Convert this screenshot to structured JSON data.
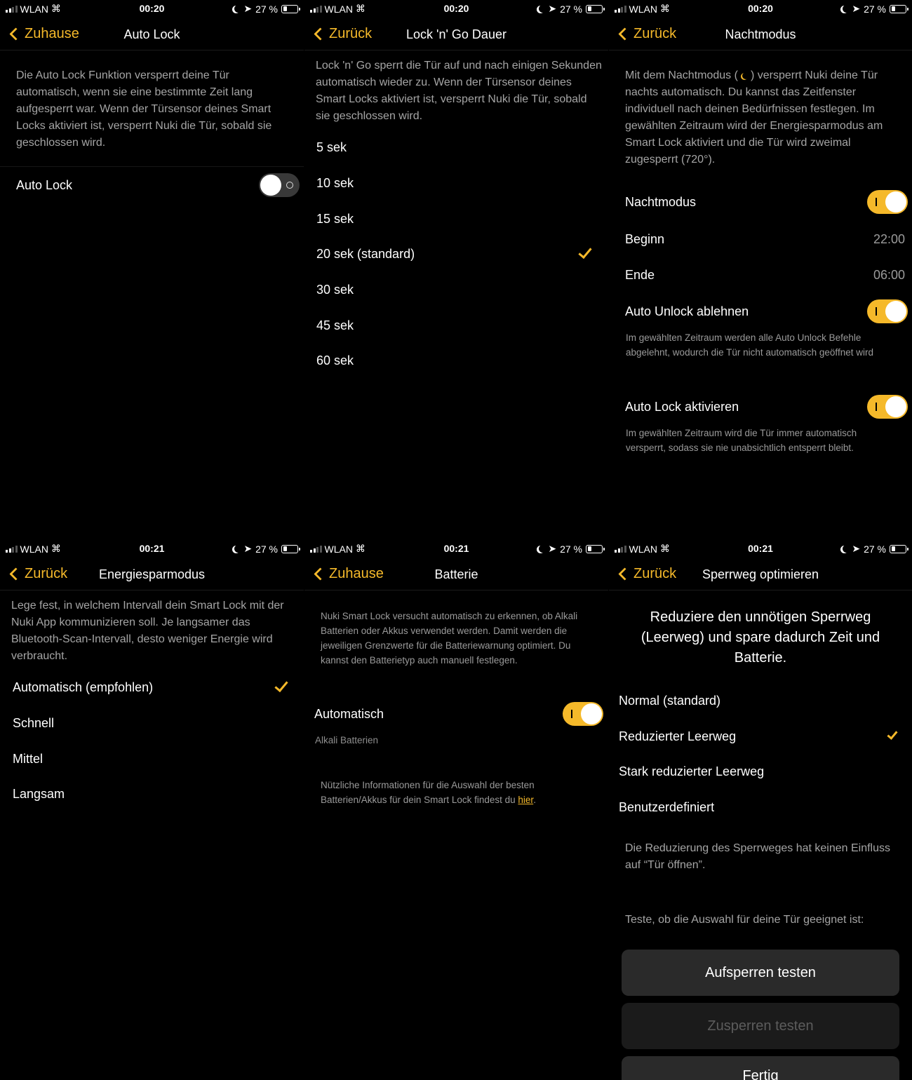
{
  "status": {
    "carrier": "WLAN",
    "battery_text": "27 %",
    "battery_level": 0.27,
    "time_top": "00:20",
    "time_bottom": "00:21"
  },
  "accent_color": "#f5b92a",
  "screens": {
    "auto_lock": {
      "back_label": "Zuhause",
      "title": "Auto Lock",
      "description": "Die Auto Lock Funktion versperrt deine Tür automatisch, wenn sie eine bestimmte Zeit lang aufgesperrt war. Wenn der Türsensor deines Smart Locks aktiviert ist, versperrt Nuki die Tür, sobald sie geschlossen wird.",
      "toggle_label": "Auto Lock",
      "toggle_on": false
    },
    "lock_n_go": {
      "back_label": "Zurück",
      "title": "Lock 'n' Go Dauer",
      "description": "Lock 'n' Go sperrt die Tür auf und nach einigen Sekunden automatisch wieder zu. Wenn der Türsensor deines Smart Locks aktiviert ist, versperrt Nuki die Tür, sobald sie geschlossen wird.",
      "options": [
        "5 sek",
        "10 sek",
        "15 sek",
        "20 sek (standard)",
        "30 sek",
        "45 sek",
        "60 sek"
      ],
      "selected": "20 sek (standard)"
    },
    "night_mode": {
      "back_label": "Zurück",
      "title": "Nachtmodus",
      "description_before": "Mit dem Nachtmodus (",
      "description_after": ") versperrt Nuki deine Tür nachts automatisch. Du kannst das Zeitfenster individuell nach deinen Bedürfnissen festlegen. Im gewählten Zeitraum wird der Energiesparmodus am Smart Lock aktiviert und die Tür wird zweimal zugesperrt (720°).",
      "nightmode_label": "Nachtmodus",
      "nightmode_on": true,
      "begin_label": "Beginn",
      "begin_value": "22:00",
      "end_label": "Ende",
      "end_value": "06:00",
      "auto_unlock_label": "Auto Unlock ablehnen",
      "auto_unlock_on": true,
      "auto_unlock_note": "Im gewählten Zeitraum werden alle Auto Unlock Befehle abgelehnt, wodurch die Tür nicht automatisch geöffnet wird",
      "auto_lock_label": "Auto Lock aktivieren",
      "auto_lock_on": true,
      "auto_lock_note": "Im gewählten Zeitraum wird die Tür immer automatisch versperrt, sodass sie nie unabsichtlich entsperrt bleibt."
    },
    "energy": {
      "back_label": "Zurück",
      "title": "Energiesparmodus",
      "description": "Lege fest, in welchem Intervall dein Smart Lock mit der Nuki App kommunizieren soll. Je langsamer das Bluetooth-Scan-Intervall, desto weniger Energie wird verbraucht.",
      "options": [
        "Automatisch (empfohlen)",
        "Schnell",
        "Mittel",
        "Langsam"
      ],
      "selected": "Automatisch (empfohlen)"
    },
    "battery": {
      "back_label": "Zuhause",
      "title": "Batterie",
      "description": "Nuki Smart Lock versucht automatisch zu erkennen, ob Alkali Batterien oder Akkus verwendet werden. Damit werden die jeweiligen Grenzwerte für die Batteriewarnung optimiert. Du kannst den Batterietyp auch manuell festlegen.",
      "auto_label": "Automatisch",
      "auto_on": true,
      "detected": "Alkali Batterien",
      "info_text": "Nützliche Informationen für die Auswahl der besten Batterien/Akkus für dein Smart Lock findest du",
      "info_link": "hier",
      "info_end": "."
    },
    "lock_path": {
      "back_label": "Zurück",
      "title": "Sperrweg optimieren",
      "heading": "Reduziere den unnötigen Sperrweg (Leerweg) und spare dadurch Zeit und Batterie.",
      "options": [
        "Normal (standard)",
        "Reduzierter Leerweg",
        "Stark reduzierter Leerweg",
        "Benutzerdefiniert"
      ],
      "selected": "Reduzierter Leerweg",
      "note": "Die Reduzierung des Sperrweges hat keinen Einfluss auf “Tür öffnen”.",
      "test_prompt": "Teste, ob die Auswahl für deine Tür geeignet ist:",
      "unlock_test": "Aufsperren testen",
      "lock_test": "Zusperren testen",
      "done": "Fertig"
    }
  }
}
